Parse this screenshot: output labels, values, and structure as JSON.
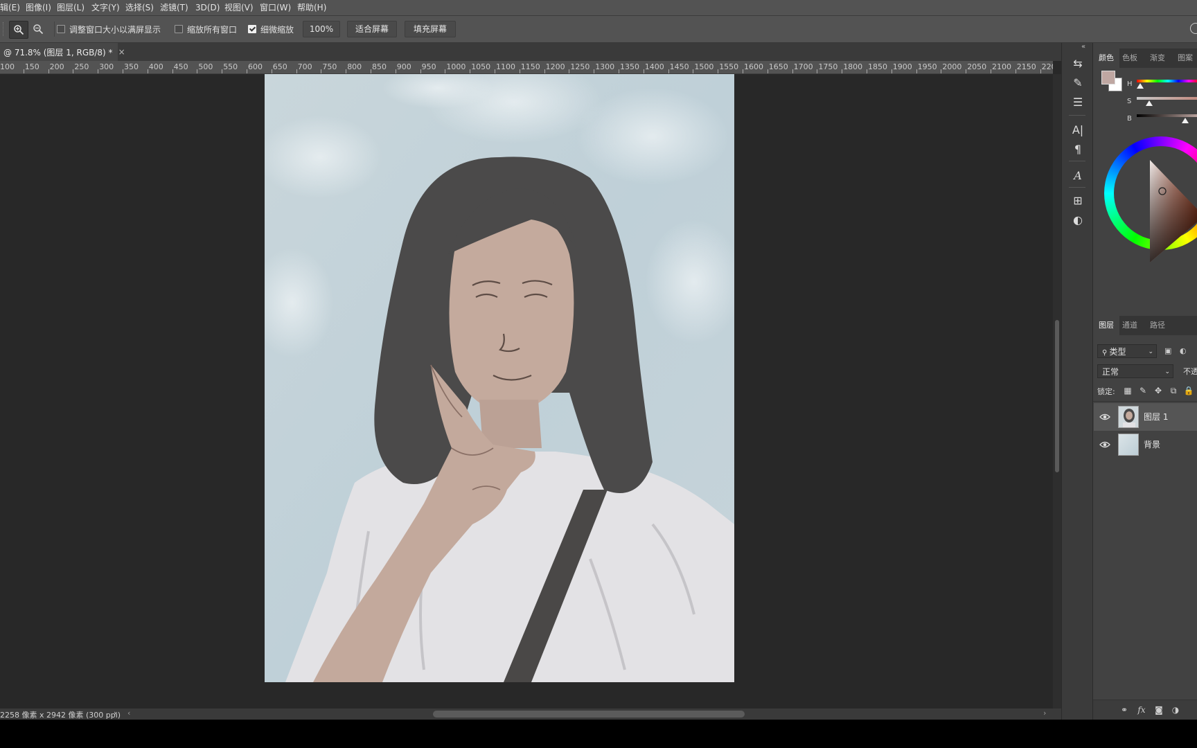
{
  "menus": [
    "辑(E)",
    "图像(I)",
    "图层(L)",
    "文字(Y)",
    "选择(S)",
    "滤镜(T)",
    "3D(D)",
    "视图(V)",
    "窗口(W)",
    "帮助(H)"
  ],
  "options": {
    "zoom_in_icon": "zoom-in-icon",
    "zoom_out_icon": "zoom-out-icon",
    "resize_windows_label": "调整窗口大小以满屏显示",
    "resize_windows_checked": false,
    "zoom_all_label": "缩放所有窗口",
    "zoom_all_checked": false,
    "scrubby_zoom_label": "细微缩放",
    "scrubby_zoom_checked": true,
    "zoom_value": "100%",
    "fit_screen_label": "适合屏幕",
    "fill_screen_label": "填充屏幕"
  },
  "document": {
    "tab_title": "@ 71.8% (图层 1, RGB/8) *",
    "close_glyph": "×"
  },
  "ruler_ticks": [
    "100",
    "150",
    "200",
    "250",
    "300",
    "350",
    "400",
    "450",
    "500",
    "550",
    "600",
    "650",
    "700",
    "750",
    "800",
    "850",
    "900",
    "950",
    "1000",
    "1050",
    "1100",
    "1150",
    "1200",
    "1250",
    "1300",
    "1350",
    "1400",
    "1450",
    "1500",
    "1550",
    "1600",
    "1650",
    "1700",
    "1750",
    "1800",
    "1850",
    "1900",
    "1950",
    "2000",
    "2050",
    "2100",
    "2150",
    "220"
  ],
  "status": {
    "doc_size": "2258 像素 x 2942 像素 (300 ppi)",
    "arrow": "›",
    "scroll_left": "‹",
    "scroll_right": "›"
  },
  "color_panel": {
    "tabs": [
      "颜色",
      "色板",
      "渐变",
      "图案"
    ],
    "active_tab": 0,
    "hsb_labels": [
      "H",
      "S",
      "B"
    ],
    "foreground_color": "#bfa7a2",
    "background_color": "#ffffff",
    "hue_level": 0.06,
    "saturation_level": 0.2,
    "brightness_level": 0.78
  },
  "layers_panel": {
    "tabs": [
      "图层",
      "通道",
      "路径"
    ],
    "active_tab": 0,
    "filter_label": "类型",
    "blend_mode": "正常",
    "opacity_label": "不透",
    "lock_label": "锁定:",
    "layers": [
      {
        "name": "图层 1",
        "visible": true,
        "selected": true
      },
      {
        "name": "背景",
        "visible": true,
        "selected": false
      }
    ],
    "bottom_icons": [
      "link-icon",
      "fx-icon",
      "mask-icon",
      "adjustment-icon"
    ]
  },
  "colors": {
    "ui_bar": "#535353",
    "canvas_bg": "#282828",
    "panel_bg": "#424242"
  }
}
